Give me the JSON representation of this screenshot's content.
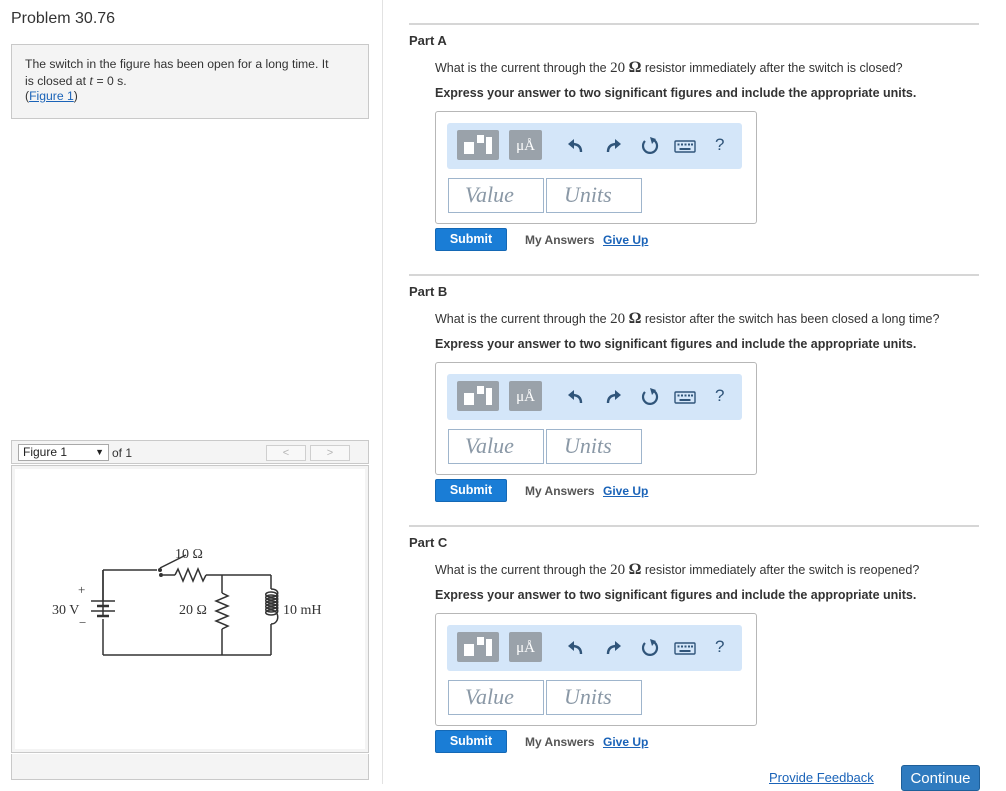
{
  "problem": {
    "title": "Problem 30.76",
    "text_line1": "The switch in the figure has been open for a long time. It",
    "text_line2_pre": "is closed at ",
    "text_line2_var": "t",
    "text_line2_post": " = 0 s.",
    "figure_link_open": "(",
    "figure_link": "Figure 1",
    "figure_link_close": ")"
  },
  "figure_nav": {
    "selected": "Figure 1",
    "of_label": "of 1",
    "prev": "<",
    "next": ">"
  },
  "circuit": {
    "battery_label": "30 V",
    "battery_plus": "+",
    "battery_minus": "−",
    "r_top_label": "10 Ω",
    "r_mid_label": "20 Ω",
    "inductor_label": "10 mH"
  },
  "toolbar": {
    "units_button": "μÅ",
    "help": "?"
  },
  "parts": [
    {
      "title": "Part A",
      "q_pre": "What is the current through the ",
      "q_num": "20",
      "q_ohm": "Ω",
      "q_post": " resistor immediately after the switch is closed?",
      "instruction": "Express your answer to two significant figures and include the appropriate units.",
      "value_placeholder": "Value",
      "units_placeholder": "Units",
      "submit": "Submit",
      "my_answers": "My Answers",
      "give_up": "Give Up"
    },
    {
      "title": "Part B",
      "q_pre": "What is the current through the ",
      "q_num": "20",
      "q_ohm": "Ω",
      "q_post": " resistor after the switch has been closed a long time?",
      "instruction": "Express your answer to two significant figures and include the appropriate units.",
      "value_placeholder": "Value",
      "units_placeholder": "Units",
      "submit": "Submit",
      "my_answers": "My Answers",
      "give_up": "Give Up"
    },
    {
      "title": "Part C",
      "q_pre": "What is the current through the ",
      "q_num": "20",
      "q_ohm": "Ω",
      "q_post": " resistor immediately after the switch is reopened?",
      "instruction": "Express your answer to two significant figures and include the appropriate units.",
      "value_placeholder": "Value",
      "units_placeholder": "Units",
      "submit": "Submit",
      "my_answers": "My Answers",
      "give_up": "Give Up"
    }
  ],
  "footer": {
    "feedback": "Provide Feedback",
    "continue": "Continue"
  },
  "colors": {
    "submit": "#1a7dd6",
    "toolbar_bg": "#d4e6f9",
    "link": "#1a63b8"
  }
}
